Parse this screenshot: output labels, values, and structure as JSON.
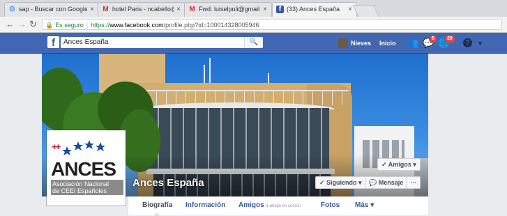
{
  "browser": {
    "tabs": [
      {
        "label": "sap - Buscar con Google",
        "icon": "google-icon"
      },
      {
        "label": "hotel Paris - ncabello@c",
        "icon": "gmail-icon"
      },
      {
        "label": "Fwd: luiselpuli@gmail.cc",
        "icon": "gmail-icon"
      },
      {
        "label": "(33) Ances España",
        "icon": "facebook-icon"
      }
    ],
    "close_glyph": "×",
    "address": {
      "secure_label": "Es seguro",
      "url_protocol": "https://",
      "url_host": "www.facebook.com",
      "url_path": "/profile.php?id=100014328005946"
    }
  },
  "facebook": {
    "logo": "f",
    "search_value": "Ances España",
    "user_name": "Nieves",
    "home_label": "Inicio",
    "friend_requests_count": "",
    "messages_count": "5",
    "notifications_count": "28"
  },
  "profile": {
    "page_name": "Ances España",
    "picture": {
      "logo_text": "ANCES",
      "cross_text": "++",
      "subtitle_line1": "Asociación Nacional",
      "subtitle_line2": "de CEEI Españoles"
    },
    "buttons": {
      "friends": "✓ Amigos ▾",
      "following": "✓ Siguiendo ▾",
      "message": "Mensaje",
      "more": "···"
    },
    "tabs": [
      {
        "label": "Biografía",
        "extra": ""
      },
      {
        "label": "Información",
        "extra": ""
      },
      {
        "label": "Amigos",
        "extra": "1 amigo en común"
      },
      {
        "label": "Fotos",
        "extra": ""
      },
      {
        "label": "Más ▾",
        "extra": ""
      }
    ]
  },
  "colors": {
    "facebook_blue": "#4267b2",
    "link_blue": "#365899",
    "notification_red": "#fa3e3e",
    "secure_green": "#188038"
  }
}
